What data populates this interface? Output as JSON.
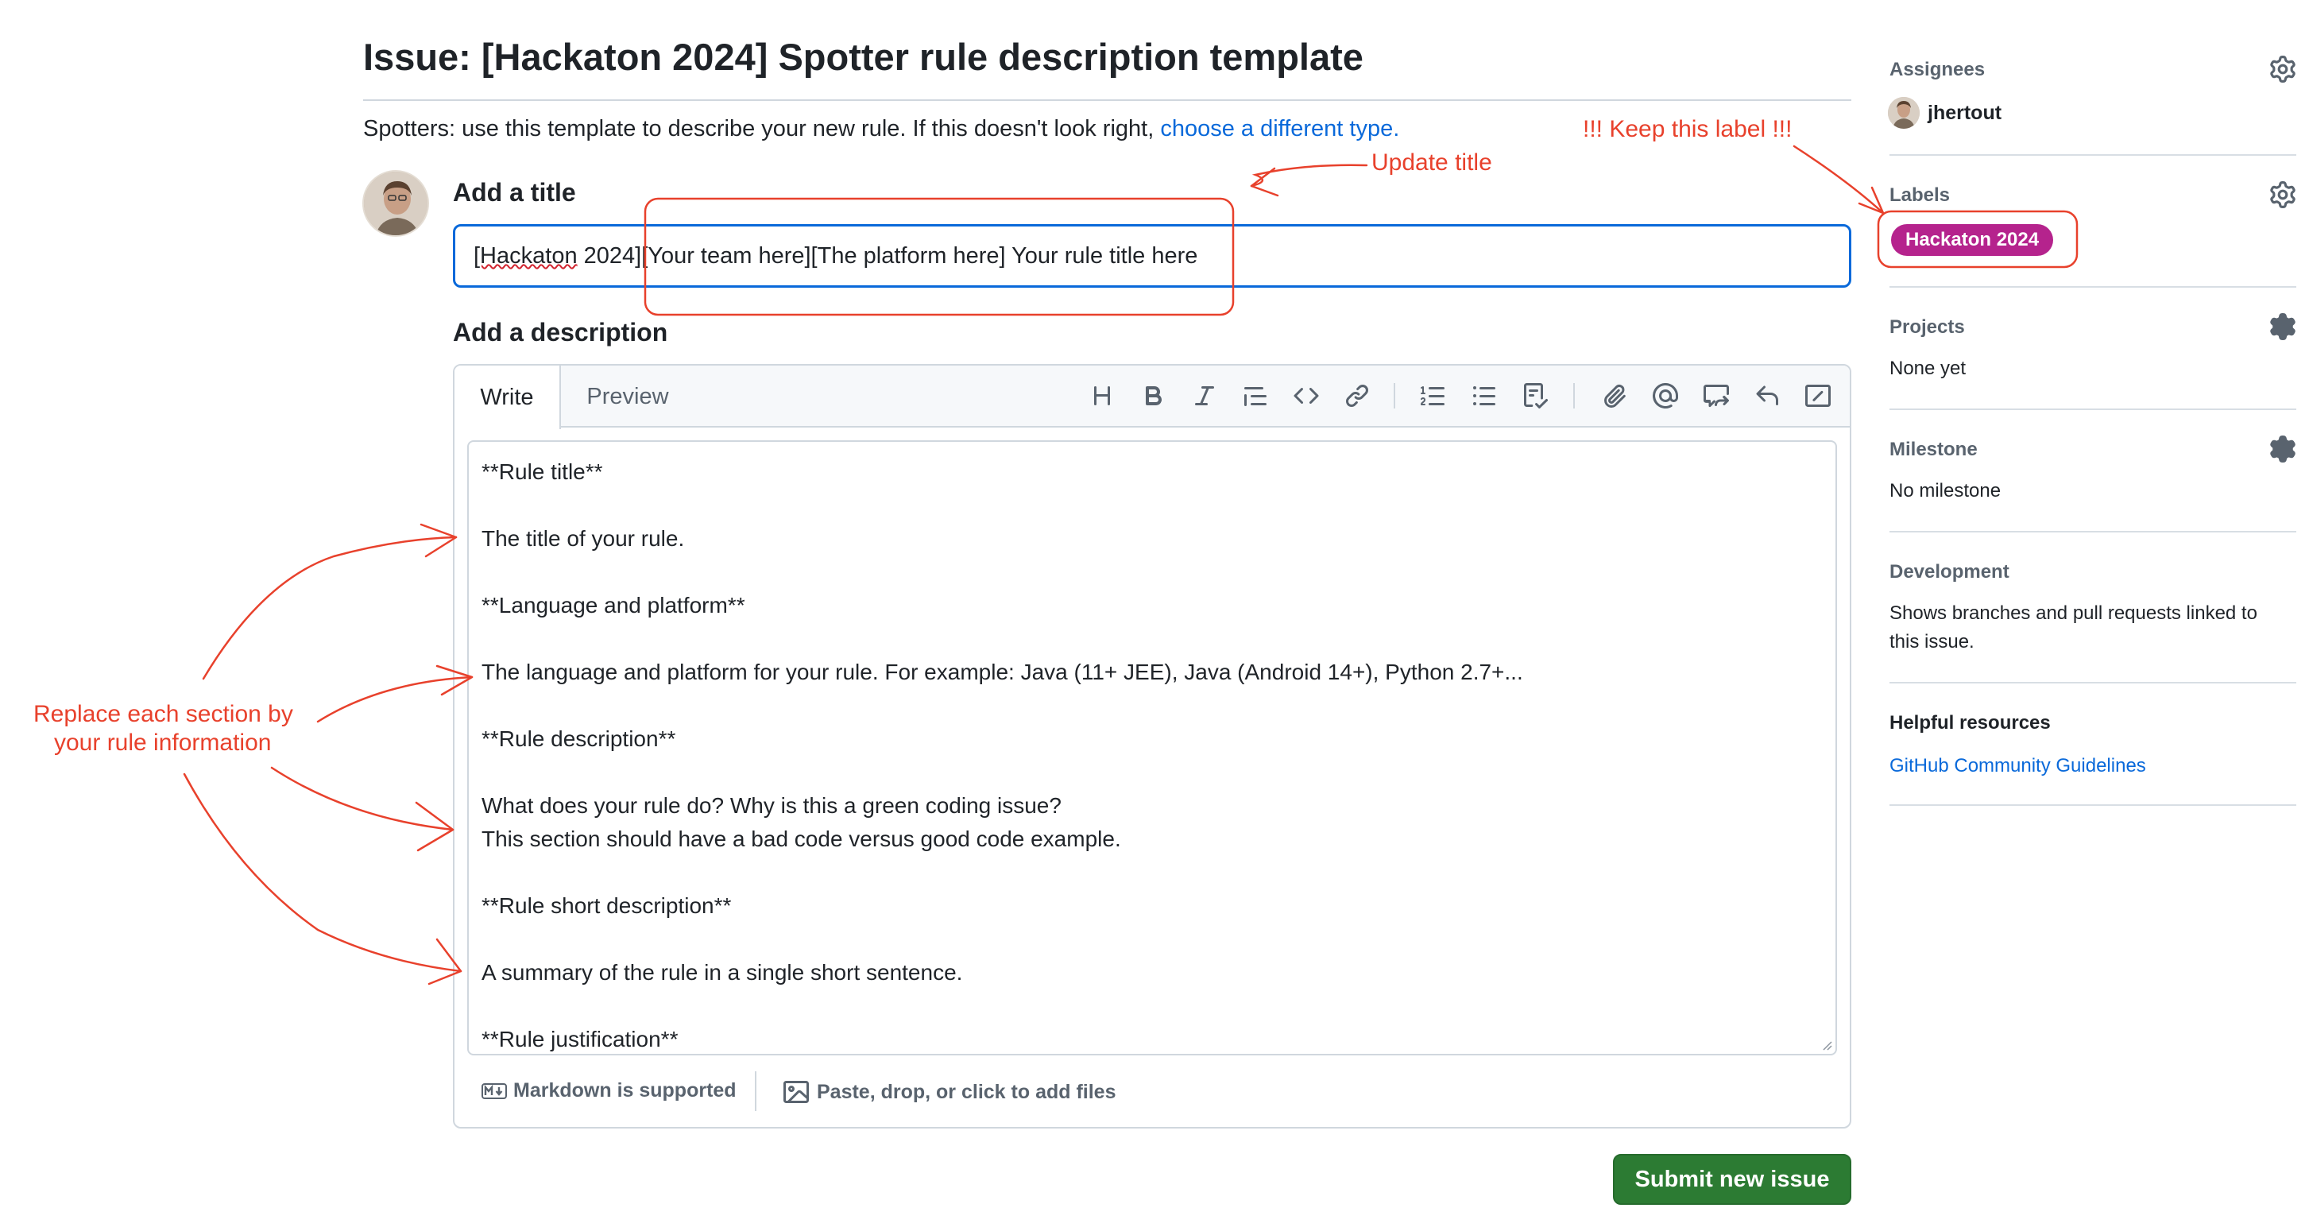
{
  "header": {
    "title": "Issue: [Hackaton 2024] Spotter rule description template",
    "note_prefix": "Spotters: use this template to describe your new rule. If this doesn't look right, ",
    "note_link": "choose a different type."
  },
  "form": {
    "title_label": "Add a title",
    "title_value_part1": "[Hackaton",
    "title_value_part2": " 2024][Your team here][The platform here] Your rule title here",
    "description_label": "Add a description",
    "tabs": {
      "write": "Write",
      "preview": "Preview"
    },
    "toolbar_icons": [
      "heading-icon",
      "bold-icon",
      "italic-icon",
      "quote-icon",
      "code-icon",
      "link-icon",
      "numbered-list-icon",
      "unordered-list-icon",
      "task-list-icon",
      "attach-icon",
      "mention-icon",
      "reference-icon",
      "undo-icon",
      "slash-commands-icon"
    ],
    "body_lines": [
      "**Rule title**",
      "",
      "The title of your rule.",
      "",
      "**Language and platform**",
      "",
      "The language and platform for your rule. For example: Java (11+ JEE), Java (Android 14+), Python 2.7+...",
      "",
      "**Rule description**",
      "",
      "What does your rule do? Why is this a green coding issue?",
      "This section should have a bad code versus good code example.",
      "",
      "**Rule short description**",
      "",
      "A summary of the rule in a single short sentence.",
      "",
      "**Rule justification**"
    ],
    "markdown_note": "Markdown is supported",
    "attach_note": "Paste, drop, or click to add files",
    "submit_label": "Submit new issue"
  },
  "sidebar": {
    "assignees": {
      "heading": "Assignees",
      "user": "jhertout"
    },
    "labels": {
      "heading": "Labels",
      "label": "Hackaton 2024",
      "label_color": "#b5238d"
    },
    "projects": {
      "heading": "Projects",
      "value": "None yet"
    },
    "milestone": {
      "heading": "Milestone",
      "value": "No milestone"
    },
    "development": {
      "heading": "Development",
      "line1": "Shows branches and pull requests linked to",
      "line2": "this issue."
    },
    "helpful": {
      "heading": "Helpful resources",
      "link": "GitHub Community Guidelines"
    }
  },
  "annotations": {
    "update_title": "Update title",
    "keep_label": "!!! Keep this label !!!",
    "replace_line1": "Replace each section by",
    "replace_line2": "your rule information",
    "color": "#e8412c"
  }
}
